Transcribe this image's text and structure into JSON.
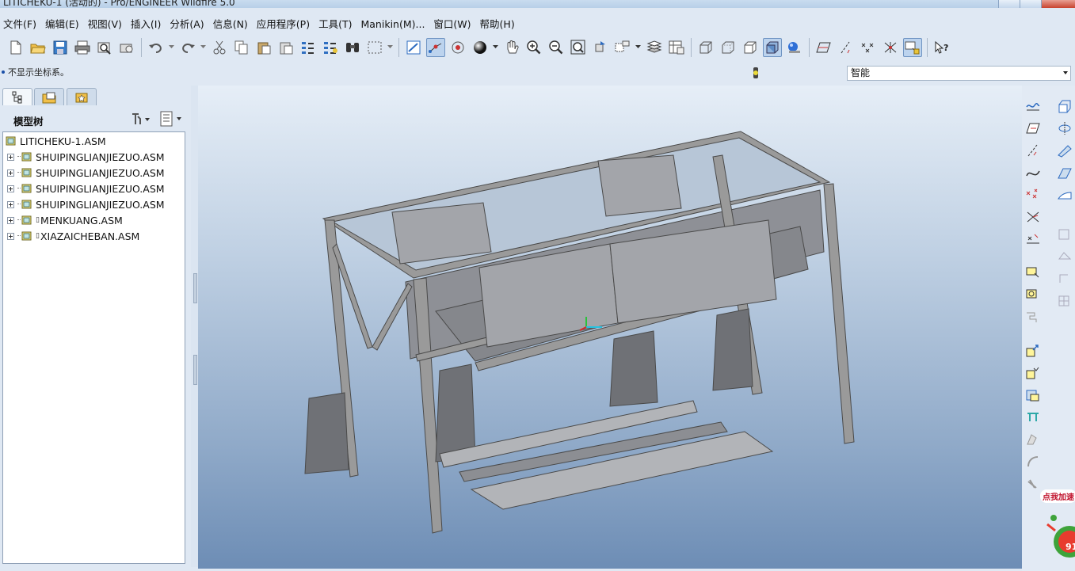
{
  "window": {
    "title": "LITICHEKU-1 (活动的) - Pro/ENGINEER Wildfire 5.0"
  },
  "menu": [
    "文件(F)",
    "编辑(E)",
    "视图(V)",
    "插入(I)",
    "分析(A)",
    "信息(N)",
    "应用程序(P)",
    "工具(T)",
    "Manikin(M)...",
    "窗口(W)",
    "帮助(H)"
  ],
  "toolbar_icons": [
    "new-file",
    "open-folder",
    "save",
    "print",
    "print-preview",
    "email",
    "undo",
    "redo",
    "cut",
    "copy",
    "paste",
    "paste-special",
    "regenerate",
    "regenerate-manager",
    "find",
    "select-box",
    "datum-display",
    "datum-points",
    "spin-center",
    "shading",
    "pan",
    "zoom-in",
    "zoom-out",
    "refit",
    "reorient",
    "saved-views",
    "layers",
    "view-manager",
    "wireframe",
    "hidden-line",
    "no-hidden",
    "shaded",
    "enhanced-realism",
    "datum-planes",
    "datum-axes",
    "point-display",
    "coord-display",
    "annotation",
    "context-help"
  ],
  "status": {
    "message": "不显示坐标系。"
  },
  "filter": {
    "value": "智能"
  },
  "model_tree": {
    "header": "模型树",
    "root": "LITICHEKU-1.ASM",
    "items": [
      {
        "name": "SHUIPINGLIANJIEZUO.ASM",
        "mark": ""
      },
      {
        "name": "SHUIPINGLIANJIEZUO.ASM",
        "mark": ""
      },
      {
        "name": "SHUIPINGLIANJIEZUO.ASM",
        "mark": ""
      },
      {
        "name": "SHUIPINGLIANJIEZUO.ASM",
        "mark": ""
      },
      {
        "name": "MENKUANG.ASM",
        "mark": "▯"
      },
      {
        "name": "XIAZAICHEBAN.ASM",
        "mark": "▯"
      }
    ]
  },
  "overlay": {
    "badge": "点我加速",
    "number": "91"
  },
  "colors": {
    "accent": "#3a6fb5",
    "viewport_top": "#e6eef7",
    "viewport_bottom": "#6d8db5",
    "model_gray": "#9a9a9a"
  }
}
